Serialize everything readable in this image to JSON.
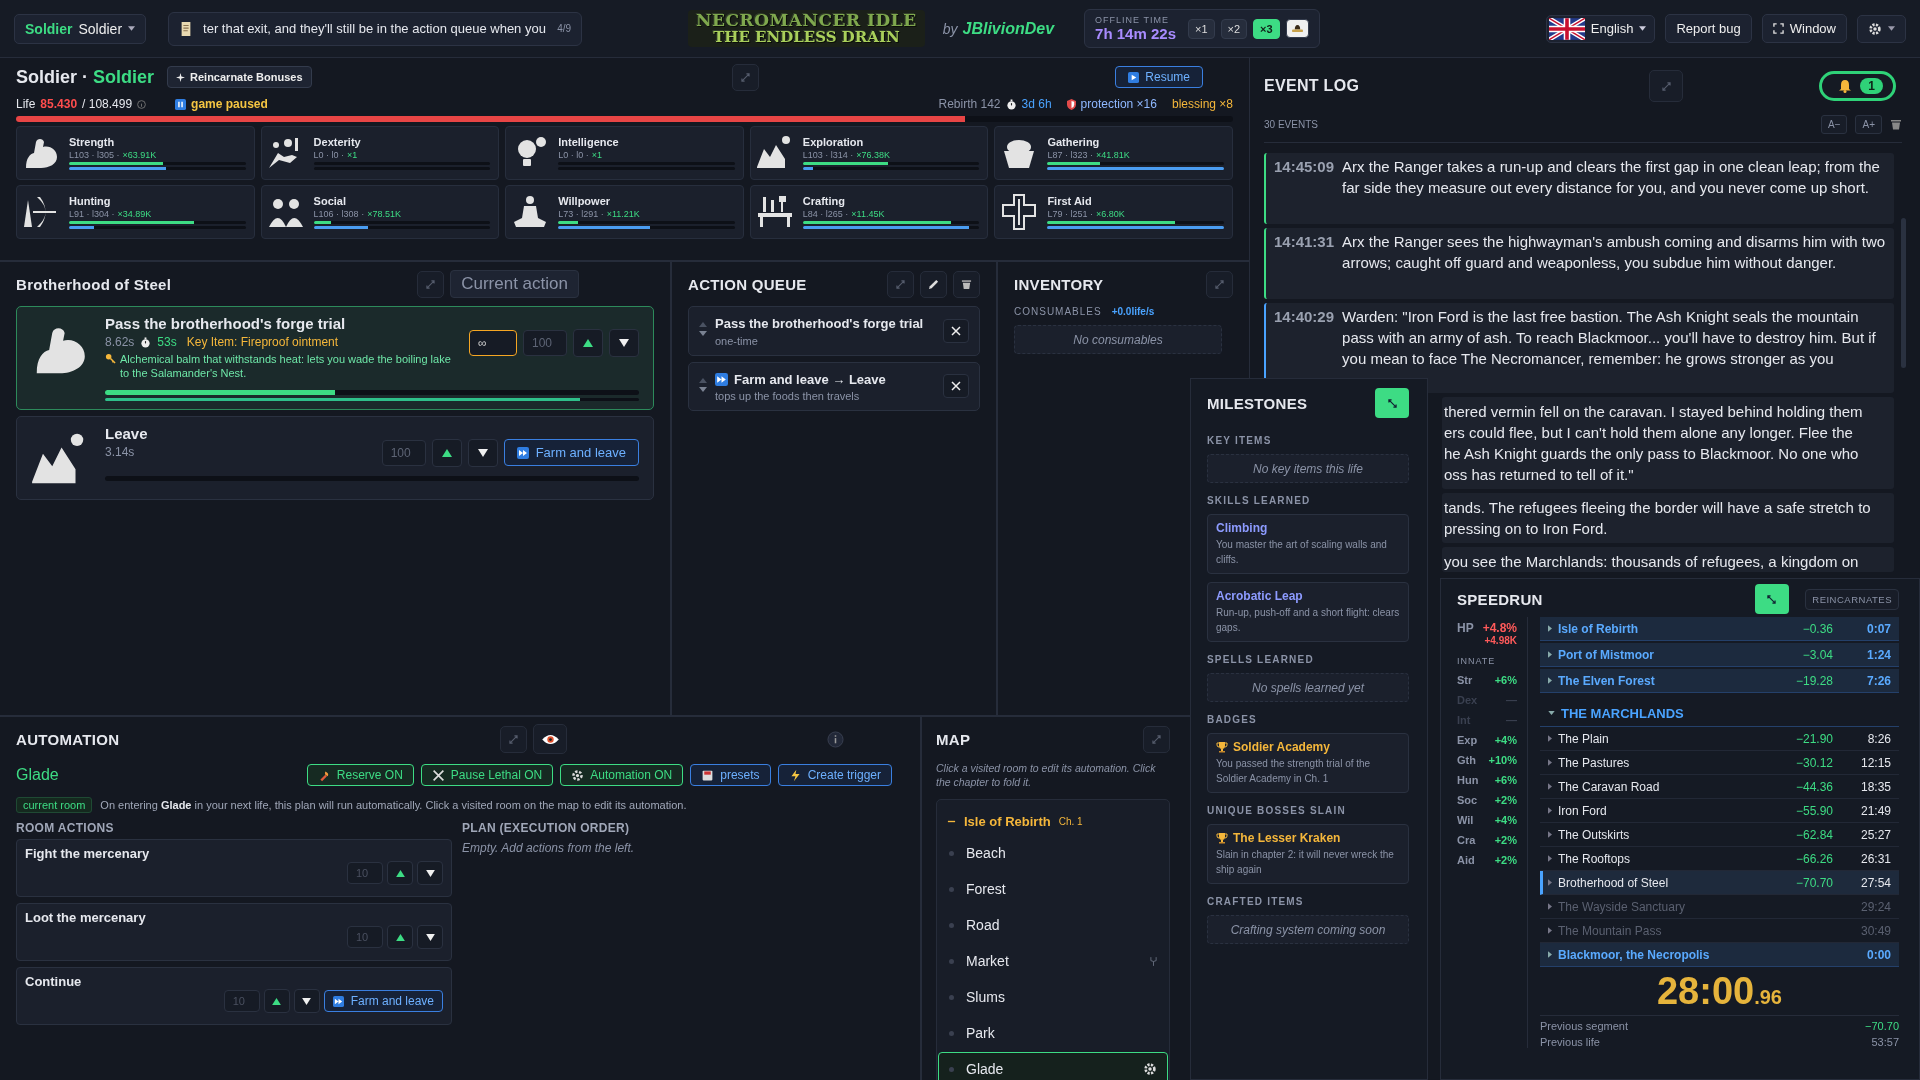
{
  "top_bar": {
    "character": {
      "class": "Soldier",
      "name": "Soldier"
    },
    "ticker": {
      "text": "ter that exit, and they'll still be in the action queue when you",
      "counter": "4/9"
    },
    "logo": {
      "line1": "NECROMANCER IDLE",
      "line2": "THE ENDLESS DRAIN"
    },
    "byline": {
      "prefix": "by",
      "author": "JBlivionDev"
    },
    "offline": {
      "label": "OFFLINE TIME",
      "value": "7h 14m 22s",
      "speeds": [
        {
          "label": "×1",
          "selected": false
        },
        {
          "label": "×2",
          "selected": false
        },
        {
          "label": "×3",
          "selected": true
        }
      ]
    },
    "language": "English",
    "report_bug": "Report bug",
    "window": "Window"
  },
  "character_panel": {
    "name": "Soldier",
    "separator": "·",
    "class": "Soldier",
    "bonuses_button": "Reincarnate Bonuses",
    "resume_button": "Resume",
    "life": {
      "label": "Life",
      "current": "85.430",
      "max": "/ 108.499",
      "level": 0.78
    },
    "paused": true,
    "paused_text": "game paused",
    "rebirth": "Rebirth 142",
    "age": "3d 6h",
    "protection": "protection ×16",
    "blessing": "blessing ×8",
    "skills": [
      {
        "name": "Strength",
        "stats": "L103 · l305 ·",
        "mult": "×63.91K",
        "bars": [
          {
            "level": 0.53
          },
          {
            "level": 0.55
          }
        ]
      },
      {
        "name": "Dexterity",
        "stats": "L0 · l0 ·",
        "mult": "×1",
        "bars": [
          {
            "level": 0
          },
          {
            "level": 0
          }
        ]
      },
      {
        "name": "Intelligence",
        "stats": "L0 · l0 ·",
        "mult": "×1",
        "bars": [
          {
            "level": 0
          },
          {
            "level": 0
          }
        ]
      },
      {
        "name": "Exploration",
        "stats": "L103 · l314 ·",
        "mult": "×76.38K",
        "bars": [
          {
            "level": 0.48
          },
          {
            "level": 0.06
          }
        ]
      },
      {
        "name": "Gathering",
        "stats": "L87 · l323 ·",
        "mult": "×41.81K",
        "bars": [
          {
            "level": 0.3
          },
          {
            "level": 1
          }
        ]
      },
      {
        "name": "Hunting",
        "stats": "L91 · l304 ·",
        "mult": "×34.89K",
        "bars": [
          {
            "level": 0.71
          },
          {
            "level": 0.14
          }
        ]
      },
      {
        "name": "Social",
        "stats": "L106 · l308 ·",
        "mult": "×78.51K",
        "bars": [
          {
            "level": 0.1
          },
          {
            "level": 0.31
          }
        ]
      },
      {
        "name": "Willpower",
        "stats": "L73 · l291 ·",
        "mult": "×11.21K",
        "bars": [
          {
            "level": 0.11
          },
          {
            "level": 0.52
          }
        ]
      },
      {
        "name": "Crafting",
        "stats": "L84 · l265 ·",
        "mult": "×11.45K",
        "bars": [
          {
            "level": 0.84
          },
          {
            "level": 0.94
          }
        ]
      },
      {
        "name": "First Aid",
        "stats": "L79 · l251 ·",
        "mult": "×6.80K",
        "bars": [
          {
            "level": 0.72
          },
          {
            "level": 1
          }
        ]
      }
    ]
  },
  "location": {
    "title": "Brotherhood of Steel",
    "current_action": "Current action",
    "actions": [
      {
        "kind": "repeat",
        "active": true,
        "title": "Pass the brotherhood's forge trial",
        "duration": "8.62s",
        "timer": "53s",
        "key_item": "Key Item: Fireproof ointment",
        "note": "Alchemical balm that withstands heat: lets you wade the boiling lake to the Salamander's Nest.",
        "reps": "∞",
        "count": "100",
        "progress": [
          {
            "level": 0.43
          },
          {
            "level": 0.89
          }
        ]
      },
      {
        "kind": "travel",
        "active": false,
        "title": "Leave",
        "duration": "3.14s",
        "count": "100",
        "button": "Farm and leave",
        "progress": [
          {
            "level": 0
          }
        ]
      }
    ]
  },
  "action_queue": {
    "title": "ACTION QUEUE",
    "items": [
      {
        "title": "Pass the brotherhood's forge trial",
        "subtitle": "one-time",
        "farm": false
      },
      {
        "title": "Farm and leave → Leave",
        "subtitle": "tops up the foods then travels",
        "farm": true
      }
    ]
  },
  "inventory": {
    "title": "INVENTORY",
    "section": "CONSUMABLES",
    "rate": "+0.0life/s",
    "empty": "No consumables"
  },
  "automation": {
    "title": "AUTOMATION",
    "room": "Glade",
    "buttons": [
      {
        "kind": "toggle",
        "label": "Reserve ON",
        "on": true
      },
      {
        "kind": "toggle",
        "label": "Pause Lethal ON",
        "on": true
      },
      {
        "kind": "toggle",
        "label": "Automation ON",
        "on": true
      },
      {
        "kind": "action",
        "label": "presets"
      },
      {
        "kind": "action",
        "label": "Create trigger"
      }
    ],
    "tag": "current room",
    "description": "On entering **Glade** in your next life, this plan will run automatically. Click a visited room on the map to edit its automation.",
    "room_actions_title": "ROOM ACTIONS",
    "room_actions": [
      {
        "title": "Fight the mercenary",
        "count": "10"
      },
      {
        "title": "Loot the mercenary",
        "count": "10"
      },
      {
        "title": "Continue",
        "count": "10",
        "button": "Farm and leave"
      }
    ],
    "plan_title": "PLAN (EXECUTION ORDER)",
    "plan_empty": "Empty. Add actions from the left."
  },
  "map": {
    "title": "MAP",
    "hint": "Click a visited room to edit its automation. Click the chapter to fold it.",
    "chapters": [
      {
        "name": "Isle of Rebirth",
        "chapter": "Ch. 1",
        "expanded": true,
        "children": [
          {
            "name": "Beach",
            "selected": false,
            "marked": false
          },
          {
            "name": "Forest",
            "selected": false,
            "marked": false
          },
          {
            "name": "Road",
            "selected": false,
            "marked": false
          },
          {
            "name": "Market",
            "selected": false,
            "marked": true
          },
          {
            "name": "Slums",
            "selected": false,
            "marked": false
          },
          {
            "name": "Park",
            "selected": false,
            "marked": false
          },
          {
            "name": "Glade",
            "selected": true,
            "marked": false
          }
        ]
      }
    ]
  },
  "event_log": {
    "title": "EVENT LOG",
    "notifications": "1",
    "count": "30 EVENTS",
    "font_smaller": "A−",
    "font_larger": "A+",
    "entries": [
      {
        "kind": "full",
        "time": "14:45:09",
        "text": "Arx the Ranger takes a run-up and clears the first gap in one clean leap; from the far side they measure out every distance for you, and you never come up short.",
        "color": "#3ddc84"
      },
      {
        "kind": "full",
        "time": "14:41:31",
        "text": "Arx the Ranger sees the highwayman's ambush coming and disarms him with two arrows; caught off guard and weaponless, you subdue him without danger.",
        "color": "#3ddc84"
      },
      {
        "kind": "full",
        "time": "14:40:29",
        "text": "Warden: \"Iron Ford is the last free bastion. The Ash Knight seals the mountain pass with an army of ash. To reach Blackmoor... you'll have to destroy him. But if you mean to face The Necromancer, remember: he grows stronger as you",
        "color": "#4aa3ff"
      },
      {
        "kind": "partial",
        "lines": [
          "thered vermin fell on the caravan. I stayed behind holding them",
          "ers could flee, but I can't hold them alone any longer. Flee the",
          "he Ash Knight guards the only pass to Blackmoor. No one who",
          "oss has returned to tell of it.\""
        ]
      },
      {
        "kind": "partial",
        "lines": [
          "tands. The refugees fleeing the border will have a safe stretch to",
          "pressing on to Iron Ford."
        ]
      },
      {
        "kind": "partial",
        "lines": [
          "you see the Marchlands: thousands of refugees, a kingdom on"
        ]
      }
    ]
  },
  "milestones": {
    "title": "MILESTONES",
    "sections": [
      {
        "kind": "empty",
        "title": "KEY ITEMS",
        "empty": "No key items this life"
      },
      {
        "kind": "skill",
        "title": "SKILLS LEARNED",
        "items": [
          {
            "name": "Climbing",
            "desc": "You master the art of scaling walls and cliffs."
          },
          {
            "name": "Acrobatic Leap",
            "desc": "Run-up, push-off and a short flight: clears gaps."
          }
        ]
      },
      {
        "kind": "empty",
        "title": "SPELLS LEARNED",
        "empty": "No spells learned yet"
      },
      {
        "kind": "trophy",
        "title": "BADGES",
        "items": [
          {
            "name": "Soldier Academy",
            "desc": "You passed the strength trial of the Soldier Academy in Ch. 1"
          }
        ]
      },
      {
        "kind": "trophy",
        "title": "UNIQUE BOSSES SLAIN",
        "items": [
          {
            "name": "The Lesser Kraken",
            "desc": "Slain in chapter 2: it will never wreck the ship again"
          }
        ]
      },
      {
        "kind": "empty",
        "title": "CRAFTED ITEMS",
        "empty": "Crafting system coming soon"
      }
    ]
  },
  "speedrun": {
    "title": "SPEEDRUN",
    "reincarnates": "REINCARNATES",
    "hp": {
      "label": "HP",
      "pct": "+4.8%",
      "abs": "+4.98K"
    },
    "innate_title": "INNATE",
    "innate": [
      {
        "label": "Str",
        "value": "+6%",
        "active": true
      },
      {
        "label": "Dex",
        "value": "—",
        "active": false
      },
      {
        "label": "Int",
        "value": "—",
        "active": false
      },
      {
        "label": "Exp",
        "value": "+4%",
        "active": true
      },
      {
        "label": "Gth",
        "value": "+10%",
        "active": true
      },
      {
        "label": "Hun",
        "value": "+6%",
        "active": true
      },
      {
        "label": "Soc",
        "value": "+2%",
        "active": true
      },
      {
        "label": "Wil",
        "value": "+4%",
        "active": true
      },
      {
        "label": "Cra",
        "value": "+2%",
        "active": true
      },
      {
        "label": "Aid",
        "value": "+2%",
        "active": true
      }
    ],
    "chapters": [
      {
        "name": "Isle of Rebirth",
        "delta": "−0.36",
        "time": "0:07",
        "expanded": false
      },
      {
        "name": "Port of Mistmoor",
        "delta": "−3.04",
        "time": "1:24",
        "expanded": false
      },
      {
        "name": "The Elven Forest",
        "delta": "−19.28",
        "time": "7:26",
        "expanded": false
      },
      {
        "name": "THE MARCHLANDS",
        "expanded": true,
        "children": [
          {
            "name": "The Plain",
            "delta": "−21.90",
            "time": "8:26",
            "selected": false,
            "reached": true
          },
          {
            "name": "The Pastures",
            "delta": "−30.12",
            "time": "12:15",
            "selected": false,
            "reached": true
          },
          {
            "name": "The Caravan Road",
            "delta": "−44.36",
            "time": "18:35",
            "selected": false,
            "reached": true
          },
          {
            "name": "Iron Ford",
            "delta": "−55.90",
            "time": "21:49",
            "selected": false,
            "reached": true
          },
          {
            "name": "The Outskirts",
            "delta": "−62.84",
            "time": "25:27",
            "selected": false,
            "reached": true
          },
          {
            "name": "The Rooftops",
            "delta": "−66.26",
            "time": "26:31",
            "selected": false,
            "reached": true
          },
          {
            "name": "Brotherhood of Steel",
            "delta": "−70.70",
            "time": "27:54",
            "selected": true,
            "reached": true
          },
          {
            "name": "The Wayside Sanctuary",
            "time": "29:24",
            "selected": false,
            "reached": false
          },
          {
            "name": "The Mountain Pass",
            "time": "30:49",
            "selected": false,
            "reached": false
          }
        ]
      },
      {
        "name": "Blackmoor, the Necropolis",
        "time": "0:00",
        "expanded": false
      }
    ],
    "timer": {
      "main": "28:00",
      "fraction": ".96"
    },
    "previous_segment": {
      "label": "Previous segment",
      "value": "−70.70"
    },
    "previous_life": {
      "label": "Previous life",
      "value": "53:57"
    }
  }
}
